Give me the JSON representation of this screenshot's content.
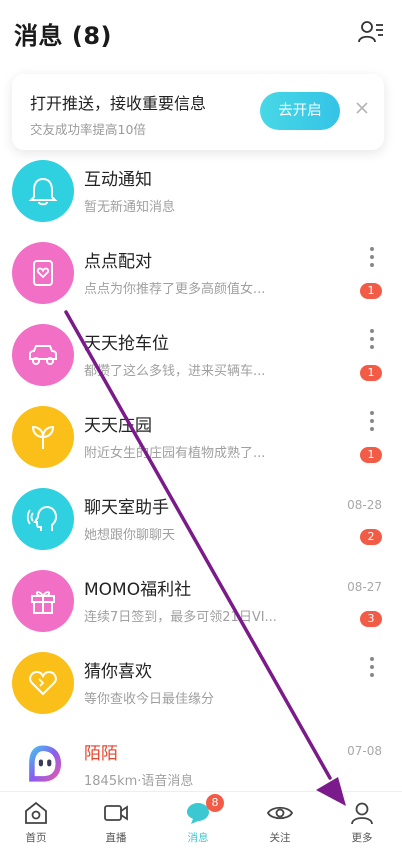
{
  "header": {
    "title": "消息 (8)",
    "contacts_icon": "contacts-list-icon"
  },
  "banner": {
    "title": "打开推送，接收重要信息",
    "subtitle": "交友成功率提高10倍",
    "button": "去开启",
    "close_icon": "close-icon"
  },
  "rows": [
    {
      "name": "互动通知",
      "msg": "暂无新通知消息",
      "time": "",
      "badge": "",
      "more": false,
      "avatar_color": "#2fd0e0",
      "icon": "bell-icon"
    },
    {
      "name": "点点配对",
      "msg": "点点为你推荐了更多高颜值女...",
      "time": "",
      "badge": "1",
      "more": true,
      "avatar_color": "#f26fc6",
      "icon": "card-heart-icon"
    },
    {
      "name": "天天抢车位",
      "msg": "都攒了这么多钱，进来买辆车...",
      "time": "",
      "badge": "1",
      "more": true,
      "avatar_color": "#f26fc6",
      "icon": "car-icon"
    },
    {
      "name": "天天庄园",
      "msg": "附近女生的庄园有植物成熟了...",
      "time": "",
      "badge": "1",
      "more": true,
      "avatar_color": "#fbbf1a",
      "icon": "sprout-icon"
    },
    {
      "name": "聊天室助手",
      "msg": "她想跟你聊聊天",
      "time": "08-28",
      "badge": "2",
      "more": false,
      "avatar_color": "#2fd0e0",
      "icon": "speaking-head-icon"
    },
    {
      "name": "MOMO福利社",
      "msg": "连续7日签到，最多可领21日VI...",
      "time": "08-27",
      "badge": "3",
      "more": false,
      "avatar_color": "#f26fc6",
      "icon": "gift-icon"
    },
    {
      "name": "猜你喜欢",
      "msg": "等你查收今日最佳缘分",
      "time": "",
      "badge": "",
      "more": true,
      "avatar_color": "#fbbf1a",
      "icon": "heart-icon"
    },
    {
      "name": "陌陌",
      "msg": "1845km·语音消息",
      "time": "07-08",
      "badge": "",
      "more": false,
      "avatar_color": "#ffffff",
      "icon": "momo-logo-icon",
      "name_color": "#e8432b"
    }
  ],
  "tabs": [
    {
      "label": "首页",
      "icon": "home-icon"
    },
    {
      "label": "直播",
      "icon": "video-camera-icon"
    },
    {
      "label": "消息",
      "icon": "message-bubble-icon",
      "badge": "8",
      "active": true
    },
    {
      "label": "关注",
      "icon": "eye-icon"
    },
    {
      "label": "更多",
      "icon": "person-icon"
    }
  ],
  "colors": {
    "accent": "#3cc8d2",
    "badge": "#f25c47",
    "annotation_arrow": "#7b1a8a"
  }
}
